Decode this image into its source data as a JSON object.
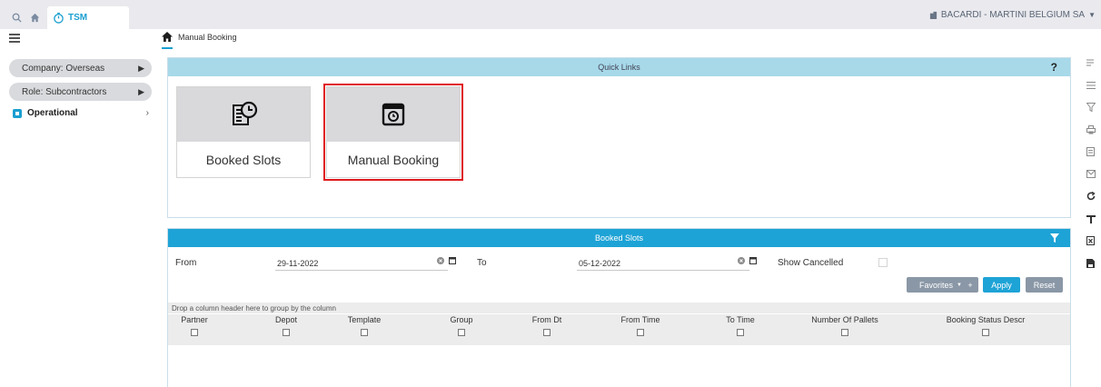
{
  "app": {
    "tab_title": "TSM",
    "company": "BACARDI - MARTINI BELGIUM SA"
  },
  "breadcrumb": {
    "page": "Manual Booking"
  },
  "sidebar": {
    "company_label": "Company: Overseas",
    "role_label": "Role: Subcontractors",
    "operational_label": "Operational"
  },
  "quick_links": {
    "title": "Quick Links",
    "help": "?",
    "tiles": [
      {
        "label": "Booked Slots",
        "icon": "schedule-list-icon"
      },
      {
        "label": "Manual Booking",
        "icon": "calendar-clock-icon"
      }
    ]
  },
  "booked_slots": {
    "title": "Booked Slots",
    "from_label": "From",
    "from_value": "29-11-2022",
    "to_label": "To",
    "to_value": "05-12-2022",
    "show_cancelled_label": "Show Cancelled",
    "favorites_label": "Favorites",
    "plus_label": "+",
    "apply_label": "Apply",
    "reset_label": "Reset",
    "group_hint": "Drop a column header here to group by the column",
    "columns": [
      "Partner",
      "Depot",
      "Template",
      "Group",
      "From Dt",
      "From Time",
      "To Time",
      "Number Of Pallets",
      "Booking Status Descr"
    ]
  },
  "colors": {
    "accent": "#1ea3d6",
    "quicklinks_header": "#a7d9e9",
    "selection": "#e0191f"
  }
}
